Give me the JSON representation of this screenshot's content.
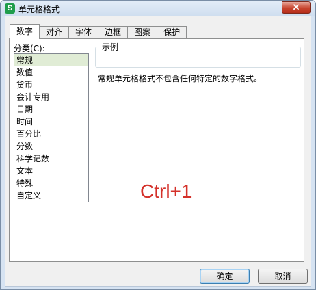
{
  "window": {
    "title": "单元格格式",
    "app_icon_letter": "S",
    "close_glyph": "✕"
  },
  "tabs": [
    {
      "label": "数字",
      "active": true
    },
    {
      "label": "对齐",
      "active": false
    },
    {
      "label": "字体",
      "active": false
    },
    {
      "label": "边框",
      "active": false
    },
    {
      "label": "图案",
      "active": false
    },
    {
      "label": "保护",
      "active": false
    }
  ],
  "category": {
    "label": "分类(C):",
    "selected": "常规",
    "items": [
      "常规",
      "数值",
      "货币",
      "会计专用",
      "日期",
      "时间",
      "百分比",
      "分数",
      "科学记数",
      "文本",
      "特殊",
      "自定义"
    ]
  },
  "sample": {
    "legend": "示例",
    "value": ""
  },
  "description": "常规单元格格式不包含任何特定的数字格式。",
  "annotation": "Ctrl+1",
  "buttons": {
    "ok": "确定",
    "cancel": "取消"
  },
  "colors": {
    "annotation": "#d4312a",
    "selected_item": "#e0ecd5",
    "close_button": "#c8442e",
    "app_icon": "#1f9d4b"
  }
}
